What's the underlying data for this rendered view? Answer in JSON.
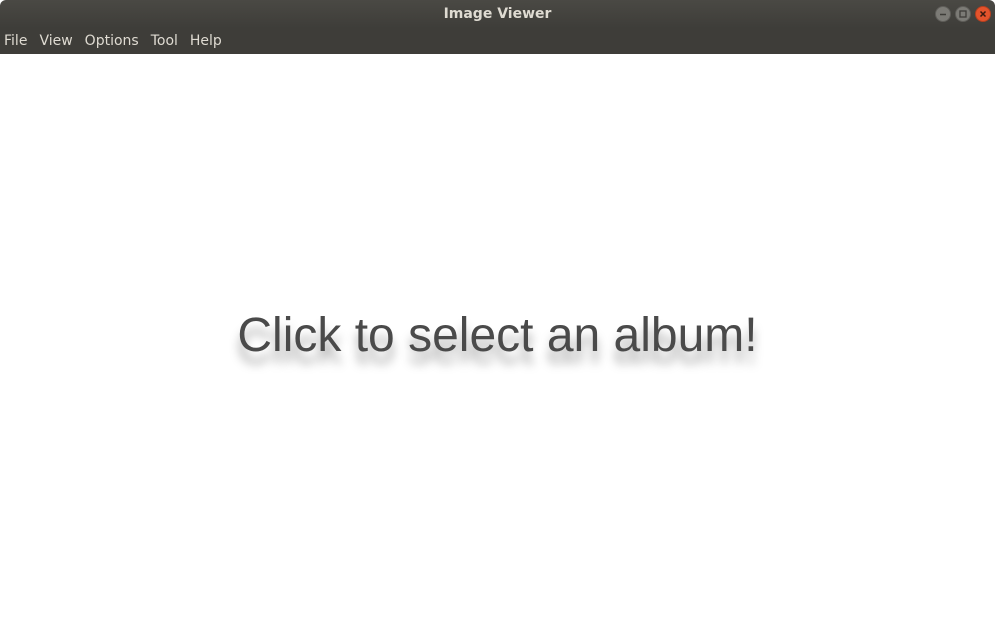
{
  "window": {
    "title": "Image Viewer",
    "controls": {
      "minimize_icon": "minimize-icon",
      "maximize_icon": "maximize-icon",
      "close_icon": "close-icon"
    }
  },
  "menubar": {
    "items": [
      {
        "label": "File"
      },
      {
        "label": "View"
      },
      {
        "label": "Options"
      },
      {
        "label": "Tool"
      },
      {
        "label": "Help"
      }
    ]
  },
  "main": {
    "prompt": "Click to select an album!"
  },
  "colors": {
    "titlebar": "#3e3d39",
    "menu_text": "#dfdbd2",
    "close_button": "#e4532c",
    "prompt_text": "#4a4a4a"
  }
}
